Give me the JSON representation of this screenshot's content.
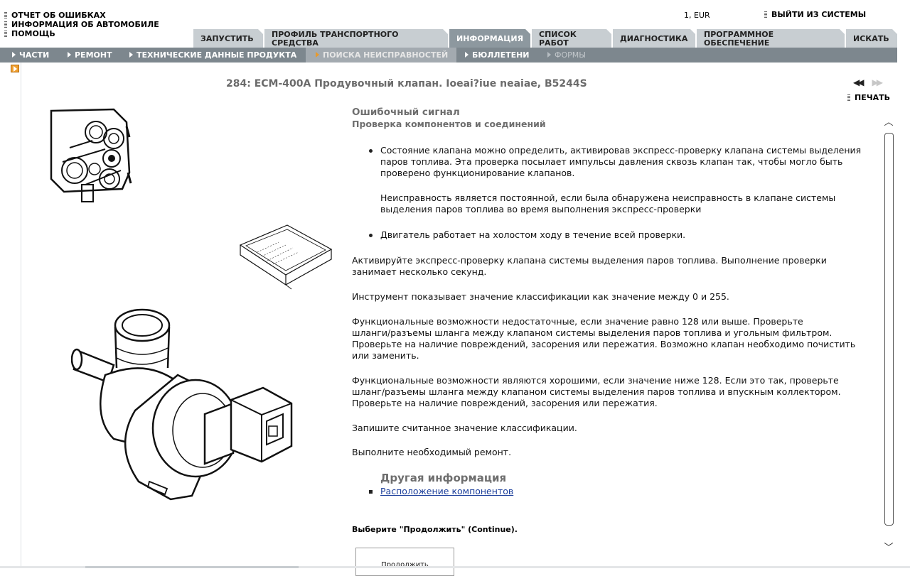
{
  "top_links": [
    "ОТЧЕТ ОБ ОШИБКАХ",
    "ИНФОРМАЦИЯ ОБ АВТОМОБИЛЕ",
    "ПОМОЩЬ"
  ],
  "currency": "1, EUR",
  "logout": "ВЫЙТИ ИЗ СИСТЕМЫ",
  "tabs": [
    {
      "label": "ЗАПУСТИТЬ",
      "active": false
    },
    {
      "label": "ПРОФИЛЬ ТРАНСПОРТНОГО СРЕДСТВА",
      "active": false
    },
    {
      "label": "ИНФОРМАЦИЯ",
      "active": true
    },
    {
      "label": "СПИСОК РАБОТ",
      "active": false
    },
    {
      "label": "ДИАГНОСТИКА",
      "active": false
    },
    {
      "label": "ПРОГРАММНОЕ ОБЕСПЕЧЕНИЕ",
      "active": false
    },
    {
      "label": "ИСКАТЬ",
      "active": false
    }
  ],
  "subnav": [
    {
      "label": "ЧАСТИ"
    },
    {
      "label": "РЕМОНТ"
    },
    {
      "label": "ТЕХНИЧЕСКИЕ ДАННЫЕ ПРОДУКТА"
    },
    {
      "label": "ПОИСКА НЕИСПРАВНОСТЕЙ",
      "active": true
    },
    {
      "label": "БЮЛЛЕТЕНИ"
    },
    {
      "label": "ФОРМЫ",
      "disabled": true
    }
  ],
  "doc": {
    "title": "284: ECM-400A Продувочный клапан. Ioeai?iue neaiae, B5244S",
    "print": "ПЕЧАТЬ",
    "heading": "Ошибочный сигнал",
    "subheading": "Проверка компонентов и соединений",
    "bullet1_lines": [
      "Состояние клапана можно определить, активировав экспресс-проверку клапана системы выделения",
      "паров топлива. Эта проверка посылает импульсы давления сквозь клапан так, чтобы могло быть",
      "проверено функционирование клапанов."
    ],
    "bullet1_note_lines": [
      "Неисправность является постоянной, если была обнаружена неисправность в клапане системы",
      "выделения паров топлива во время выполнения экспресс-проверки"
    ],
    "bullet2": "Двигатель работает на холостом ходу в течение всей проверки.",
    "para1_lines": [
      "Активируйте экспресс-проверку клапана системы выделения паров топлива. Выполнение проверки",
      "занимает несколько секунд."
    ],
    "para2": "Инструмент показывает значение классификации как значение между 0 и 255.",
    "para3_lines": [
      "Функциональные возможности недостаточные, если значение равно 128 или выше. Проверьте",
      "шланги/разъемы шланга между клапаном системы выделения паров топлива и угольным фильтром.",
      "Проверьте на наличие повреждений, засорения или пережатия. Возможно клапан необходимо почистить",
      "или заменить."
    ],
    "para4_lines": [
      "Функциональные возможности являются хорошими, если значение ниже 128. Если это так, проверьте",
      "шланг/разъемы шланга между клапаном системы выделения паров топлива и впускным коллектором.",
      "Проверьте на наличие повреждений, засорения или пережатия."
    ],
    "para5": "Запишите считанное значение классификации.",
    "para6": "Выполните необходимый ремонт.",
    "other_heading": "Другая информация",
    "other_link": "Расположение компонентов",
    "continue_prompt": "Выберите \"Продолжить\" (Continue).",
    "continue_button": "Продолжить"
  }
}
